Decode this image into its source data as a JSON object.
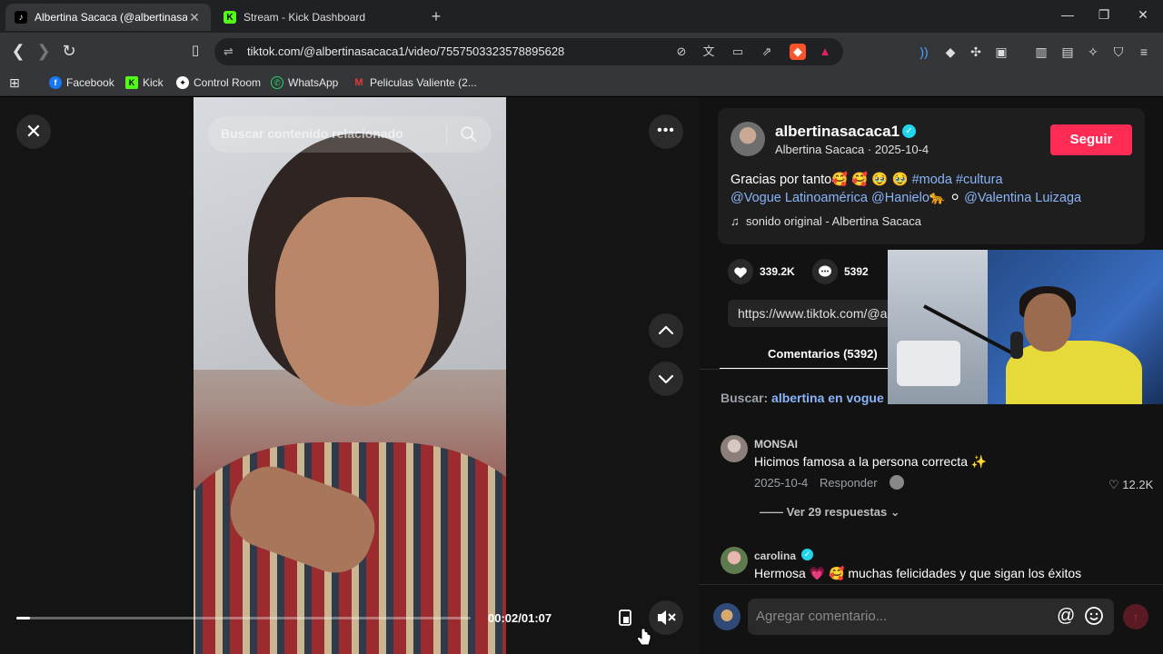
{
  "browser": {
    "tabs": [
      {
        "title": "Albertina Sacaca (@albertinasaca",
        "favicon": "tiktok-icon",
        "active": true
      },
      {
        "title": "Stream - Kick Dashboard",
        "favicon": "kick-icon",
        "active": false
      }
    ],
    "url": "tiktok.com/@albertinasacaca1/video/7557503323578895628",
    "bookmarks": [
      {
        "label": "Facebook",
        "icon": "facebook-icon",
        "color": "#1877f2"
      },
      {
        "label": "Kick",
        "icon": "kick-icon",
        "color": "#53fc18"
      },
      {
        "label": "Control Room",
        "icon": "control-room-icon",
        "color": "#ffffff"
      },
      {
        "label": "WhatsApp",
        "icon": "whatsapp-icon",
        "color": "#25d366"
      },
      {
        "label": "Peliculas Valiente (2...",
        "icon": "peliculas-icon",
        "color": "#e53935"
      }
    ]
  },
  "player": {
    "search_placeholder": "Buscar contenido relacionado",
    "time": "00:02/01:07",
    "progress": 0.03
  },
  "post": {
    "username": "albertinasacaca1",
    "subline": "Albertina Sacaca · 2025-10-4",
    "follow_label": "Seguir",
    "caption_text": "Gracias por tanto🥰 🥰 🥹 🥹 ",
    "hashtags": "#moda #cultura",
    "mention1": "@Vogue Latinoamérica",
    "mention2": "@Hanielo",
    "mention2_emoji": "🐆 ⚪",
    "mention3": "@Valentina Luizaga",
    "music_icon": "♫",
    "music": "sonido original - Albertina Sacaca",
    "likes": "339.2K",
    "comments_count": "5392",
    "link": "https://www.tiktok.com/@a"
  },
  "comments": {
    "tab_label": "Comentarios (5392)",
    "search_prefix": "Buscar:",
    "search_term": "albertina en vogue",
    "items": [
      {
        "user": "MONSAI",
        "text": "Hicimos famosa a la persona correcta ✨",
        "date": "2025-10-4",
        "reply": "Responder",
        "likes": "♡ 12.2K",
        "replies": "—— Ver 29 respuestas ⌄"
      },
      {
        "user": "carolina",
        "text": "Hermosa 💗 🥰 muchas felicidades y que sigan los éxitos"
      }
    ],
    "input_placeholder": "Agregar comentario..."
  },
  "accent": "#fe2c55"
}
